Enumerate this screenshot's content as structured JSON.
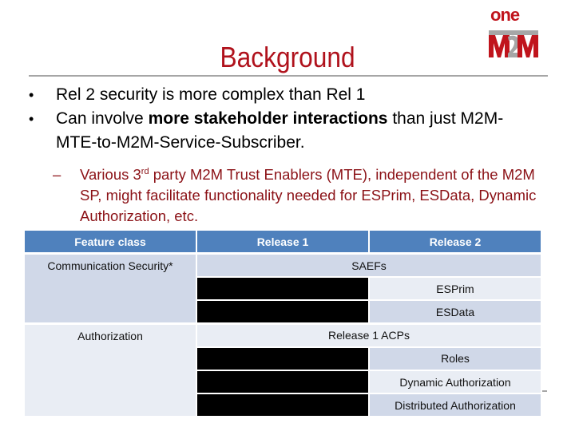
{
  "logo": {
    "top_text": "one",
    "main_text": "M2M",
    "colors": {
      "red": "#c0141c",
      "gray": "#a6a6a6"
    }
  },
  "slide": {
    "title": "Background",
    "title_color": "#b0121c",
    "bullets": [
      {
        "text_parts": [
          {
            "text": "Rel 2 security is more complex than Rel 1",
            "bold": false
          }
        ]
      },
      {
        "text_parts": [
          {
            "text": "Can involve ",
            "bold": false
          },
          {
            "text": "more stakeholder interactions",
            "bold": true
          },
          {
            "text": " than just M2M-MTE-to-M2M-Service-Subscriber.",
            "bold": false
          }
        ]
      }
    ],
    "sub_bullet": {
      "dash": "–",
      "before_sup": "Various 3",
      "sup": "rd",
      "after_sup": " party M2M Trust Enablers (MTE), independent of the M2M SP, might facilitate functionality needed for ESPrim, ESData, Dynamic Authorization, etc.",
      "color": "#8b1116"
    }
  },
  "table": {
    "headers": [
      "Feature class",
      "Release 1",
      "Release 2"
    ],
    "colors": {
      "header": "#4f81bd",
      "dark_band": "#d0d8e8",
      "light_band": "#e9edf4",
      "redacted": "#000000"
    },
    "groups": [
      {
        "feature_class": "Communication Security*",
        "rows": [
          {
            "span_both": true,
            "text": "SAEFs"
          },
          {
            "release1": "",
            "release1_redacted": true,
            "release2": "ESPrim"
          },
          {
            "release1": "",
            "release1_redacted": true,
            "release2": "ESData"
          }
        ]
      },
      {
        "feature_class": "Authorization",
        "rows": [
          {
            "span_both": true,
            "text": "Release 1 ACPs"
          },
          {
            "release1": "",
            "release1_redacted": true,
            "release2": "Roles"
          },
          {
            "release1": "",
            "release1_redacted": true,
            "release2": "Dynamic Authorization"
          },
          {
            "release1": "",
            "release1_redacted": true,
            "release2": "Distributed Authorization"
          }
        ]
      }
    ]
  }
}
